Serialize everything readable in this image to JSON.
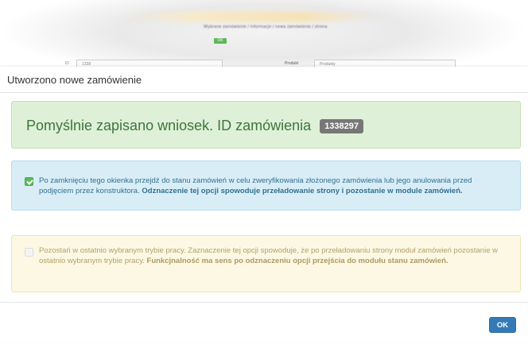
{
  "background": {
    "top_line": "Wybrane zamówienie / informacje / nowa zamówienie / strona",
    "chip": "OK",
    "field1_label": "ID",
    "field1_value": "1338",
    "field2_label": "Produkt",
    "field2_value": "Produkty"
  },
  "modal": {
    "title": "Utworzono nowe zamówienie",
    "success_message": "Pomyślnie zapisano wniosek. ID zamówienia",
    "order_id": "1338297",
    "option1": {
      "checked": true,
      "text": "Po zamknięciu tego okienka przejdź do stanu zamówień w celu zweryfikowania złożonego zamówienia lub jego anulowania przed podjęciem przez konstruktora.",
      "bold_text": "Odznaczenie tej opcji spowoduje przeładowanie strony i pozostanie w module zamówień."
    },
    "option2": {
      "checked": false,
      "text": "Pozostań w ostatnio wybranym trybie pracy. Zaznaczenie tej opcji spowoduje, że po przeładowaniu strony moduł zamówień pozostanie w ostatnio wybranym trybie pracy.",
      "bold_text": "Funkcjnalność ma sens po odznaczeniu opcji przejścia do modułu stanu zamówień."
    },
    "ok_label": "OK"
  },
  "colors": {
    "success_bg": "#dff0d8",
    "info_bg": "#d9edf7",
    "warning_bg": "#fcf8e3",
    "primary": "#337ab7",
    "checkbox_on": "#5cb85c"
  }
}
